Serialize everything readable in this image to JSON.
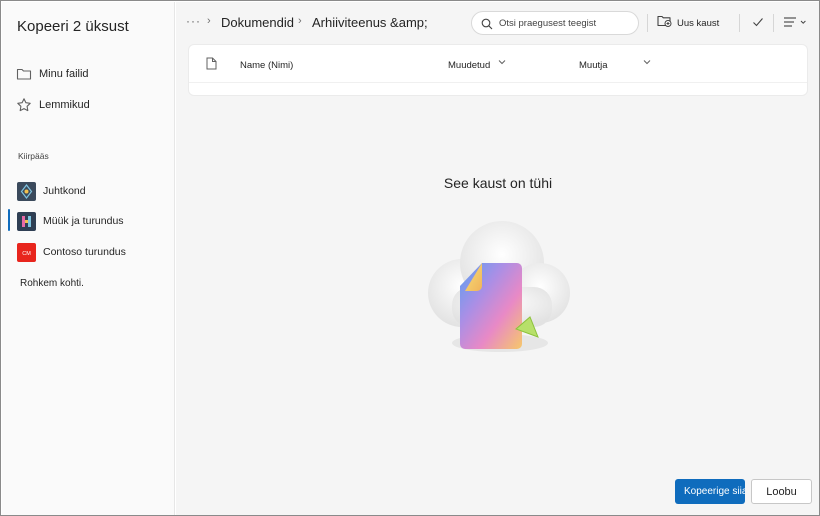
{
  "dialog": {
    "title": "Kopeeri 2 üksust"
  },
  "sidebar": {
    "nav": [
      {
        "label": "Minu failid",
        "icon": "folder-icon"
      },
      {
        "label": "Lemmikud",
        "icon": "star-icon"
      }
    ],
    "quick_access_label": "Kiirpääs",
    "sites": [
      {
        "label": "Juhtkond",
        "color": "#3b4a5c"
      },
      {
        "label": "Müük ja turundus",
        "color": "#2f3f54",
        "selected": true
      },
      {
        "label": "Contoso turundus",
        "color": "#e8251d",
        "tile_text": "CM"
      }
    ],
    "more_places": "Rohkem kohti."
  },
  "toolbar": {
    "overflow": "···",
    "breadcrumb": [
      "Dokumendid",
      "Arhiiviteenus &amp;"
    ],
    "search_placeholder": "Otsi praegusest teegist",
    "new_folder": "Uus kaust"
  },
  "list": {
    "columns": [
      "Name (Nimi)",
      "Muudetud",
      "Muutja"
    ]
  },
  "empty_state": {
    "title": "See kaust on tühi"
  },
  "footer": {
    "primary": "Kopeerige siia",
    "secondary": "Loobu"
  },
  "colors": {
    "accent": "#0f6cbd",
    "canvas": "#f5f5f5"
  }
}
